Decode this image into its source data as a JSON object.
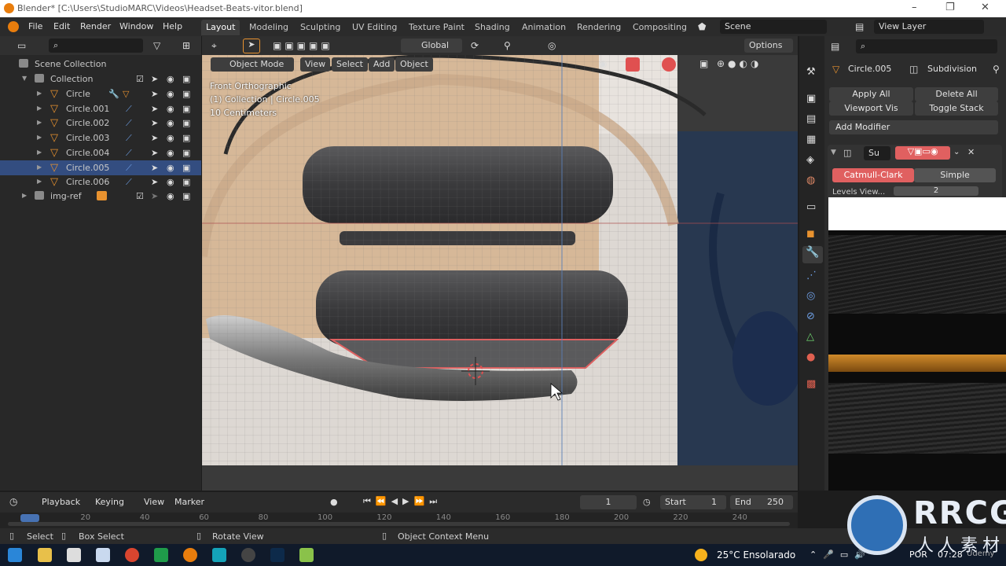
{
  "window": {
    "title": "Blender* [C:\\Users\\StudioMARC\\Videos\\Headset-Beats-vitor.blend]",
    "controls": [
      "–",
      "❐",
      "✕"
    ]
  },
  "menubar": {
    "menus": [
      "File",
      "Edit",
      "Render",
      "Window",
      "Help"
    ],
    "workspaces": [
      "Layout",
      "Modeling",
      "Sculpting",
      "UV Editing",
      "Texture Paint",
      "Shading",
      "Animation",
      "Rendering",
      "Compositing"
    ],
    "active_workspace": "Layout",
    "scene": "Scene",
    "view_layer": "View Layer"
  },
  "outliner": {
    "root": "Scene Collection",
    "collection": "Collection",
    "objects": [
      {
        "name": "Circle",
        "selected": false,
        "modifiers": true
      },
      {
        "name": "Circle.001",
        "selected": false
      },
      {
        "name": "Circle.002",
        "selected": false
      },
      {
        "name": "Circle.003",
        "selected": false
      },
      {
        "name": "Circle.004",
        "selected": false
      },
      {
        "name": "Circle.005",
        "selected": true
      },
      {
        "name": "Circle.006",
        "selected": false
      }
    ],
    "img_ref": "img-ref"
  },
  "viewport": {
    "mode": "Object Mode",
    "menus": [
      "View",
      "Select",
      "Add",
      "Object"
    ],
    "transform_orientation": "Global",
    "options_label": "Options",
    "overlay_lines": [
      "Front Orthographic",
      "(1) Collection | Circle.005",
      "10 Centimeters"
    ]
  },
  "properties": {
    "object_name": "Circle.005",
    "modifier_label": "Subdivision",
    "apply_all": "Apply All",
    "delete_all": "Delete All",
    "viewport_vis": "Viewport Vis",
    "toggle_stack": "Toggle Stack",
    "add_modifier": "Add Modifier",
    "modifier_short": "Su",
    "catmull": "Catmull-Clark",
    "simple": "Simple",
    "levels_label": "Levels View...",
    "levels_value": "2"
  },
  "timeline": {
    "menus": [
      "Playback",
      "Keying",
      "View",
      "Marker"
    ],
    "current_frame": "1",
    "start_label": "Start",
    "start_value": "1",
    "end_label": "End",
    "end_value": "250",
    "ticks": [
      "1",
      "20",
      "40",
      "60",
      "80",
      "100",
      "120",
      "140",
      "160",
      "180",
      "200",
      "220",
      "240"
    ]
  },
  "status": {
    "select": "Select",
    "box_select": "Box Select",
    "rotate_view": "Rotate View",
    "context_menu": "Object Context Menu"
  },
  "taskbar": {
    "weather": "25°C  Ensolarado",
    "lang": "POR",
    "time": "07:28",
    "extra": "Udemy"
  },
  "watermark": {
    "brand": "RRCG",
    "sub": "人人素材"
  },
  "colors": {
    "accent": "#4772b3",
    "selected_row": "#334d80",
    "object_orange": "#e8922f",
    "active_modifier": "#e06060"
  }
}
